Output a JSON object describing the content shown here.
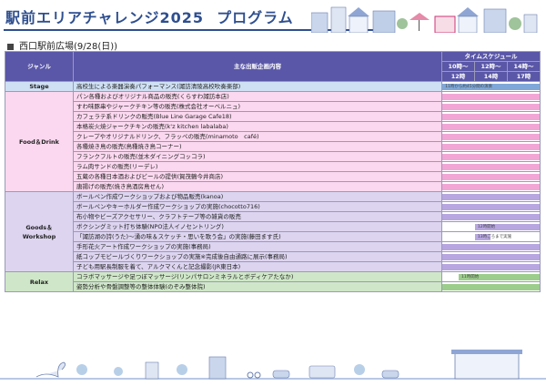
{
  "header": {
    "title": "駅前エリアチャレンジ2025",
    "subtitle_word": "プログラム",
    "venue": "西口駅前広場(9/28(日))"
  },
  "table": {
    "col_genre": "ジャンル",
    "col_content": "主な出販企画内容",
    "col_schedule": "タイムスケジュール",
    "time_slots": [
      {
        "start": "10時～",
        "end": "12時"
      },
      {
        "start": "12時～",
        "end": "14時"
      },
      {
        "start": "14時～",
        "end": "17時"
      }
    ],
    "groups": [
      {
        "genre": "Stage",
        "rows": [
          {
            "text": "高校生による楽器演奏パフォーマンス(諏訪清陵高校吹奏楽部)",
            "note": "11時から約45分間の演奏",
            "bar": [
              0.0,
              1.0
            ],
            "color": "#7fa8d8"
          }
        ]
      },
      {
        "genre": "Food＆Drink",
        "rows": [
          {
            "text": "パン各種およびオリジナル商品の販売(くらすわ諏訪本店)",
            "bar": [
              0.0,
              1.0
            ],
            "color": "#f2a6d6"
          },
          {
            "text": "すわ味豚串やジャークチキン等の販売(株式会社オーベルニュ)",
            "bar": [
              0.0,
              1.0
            ],
            "color": "#f2a6d6"
          },
          {
            "text": "カフェラテ系ドリンクの販売(Blue Line Garage Cafe18)",
            "bar": [
              0.0,
              1.0
            ],
            "color": "#f2a6d6"
          },
          {
            "text": "本格炭火焼ジャークチキンの販売(k'z kitchen labalaba)",
            "bar": [
              0.0,
              1.0
            ],
            "color": "#f2a6d6"
          },
          {
            "text": "クレープやオリジナルドリンク、フラッペの販売(minamoto　café)",
            "bar": [
              0.0,
              1.0
            ],
            "color": "#f2a6d6"
          },
          {
            "text": "各種焼き鳥の販売(鳥種焼き鳥コーナー)",
            "bar": [
              0.0,
              1.0
            ],
            "color": "#f2a6d6"
          },
          {
            "text": "フランクフルトの販売(並木ダイニングコッコラ)",
            "bar": [
              0.0,
              1.0
            ],
            "color": "#f2a6d6"
          },
          {
            "text": "ラム肉サンドの販売(リーデレ)",
            "bar": [
              0.0,
              1.0
            ],
            "color": "#f2a6d6"
          },
          {
            "text": "五蔵の各種日本酒およびビールの提供(賀茂鶴今井商店)",
            "bar": [
              0.0,
              1.0
            ],
            "color": "#f2a6d6"
          },
          {
            "text": "唐揚げの販売(焼き鳥酒房鳥せん)",
            "bar": [
              0.0,
              1.0
            ],
            "color": "#f2a6d6"
          }
        ]
      },
      {
        "genre": "Goods＆Workshop",
        "genre_line1": "Goods＆",
        "genre_line2": "Workshop",
        "rows": [
          {
            "text": "ボールペン作成ワークショップおよび物品販売(kanoa)",
            "bar": [
              0.0,
              1.0
            ],
            "color": "#b7a6e0"
          },
          {
            "text": "ボールペンやキーホルダー作成ワークショップの実施(chocotto716)",
            "bar": [
              0.0,
              1.0
            ],
            "color": "#b7a6e0"
          },
          {
            "text": "布小物やビーズアクセサリー、クラフトテープ等の雑貨の販売",
            "bar": [
              0.0,
              1.0
            ],
            "color": "#b7a6e0"
          },
          {
            "text": "ボクシングミット打ち体験(NPO法人イノセントリング)",
            "note": "12時開始",
            "bar": [
              0.3333,
              1.0
            ],
            "color": "#b7a6e0"
          },
          {
            "text": "「諏訪湖の詩(うた)～湧の味＆スケッチ・思いを歌う会」の実施(藤田ます氏)",
            "note": "13時ごろまで実施",
            "bar": [
              0.3333,
              0.5
            ],
            "color": "#b7a6e0"
          },
          {
            "text": "手形花火アート作成ワークショップの実施(事務局)",
            "bar": [
              0.0,
              1.0
            ],
            "color": "#b7a6e0"
          },
          {
            "text": "紙コップモビールづくりワークショップの実施※完成後自由通路に展示(事務局)",
            "bar": [
              0.0,
              1.0
            ],
            "color": "#b7a6e0"
          },
          {
            "text": "子ども用駅長制服を着て、アルクマくんと記念撮影(JR東日本)",
            "bar": [
              0.0,
              1.0
            ],
            "color": "#b7a6e0"
          }
        ]
      },
      {
        "genre": "Relax",
        "rows": [
          {
            "text": "コラボマッサージや足つぼマッサージ(リンパサロンミネラルとボディケアたなか)",
            "note": "11時開始",
            "bar": [
              0.1667,
              1.0
            ],
            "color": "#9ccd8c"
          },
          {
            "text": "姿勢分析や骨盤調整等の整体体験(のぞみ整体院)",
            "bar": [
              0.0,
              1.0
            ],
            "color": "#9ccd8c"
          }
        ]
      }
    ]
  }
}
